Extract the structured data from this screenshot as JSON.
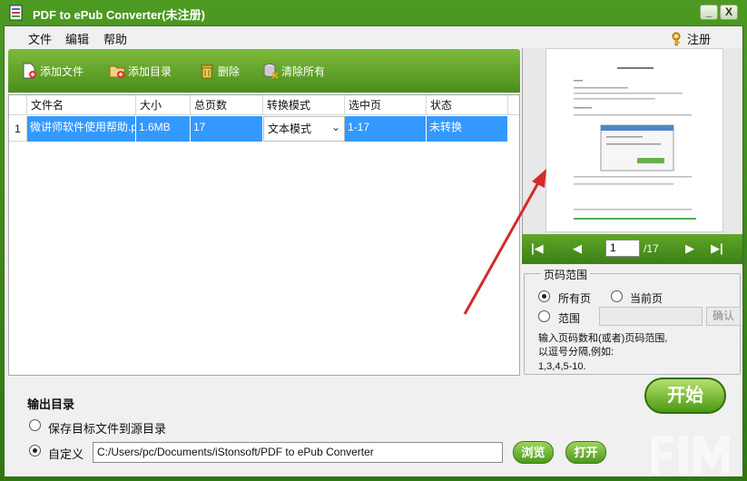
{
  "window": {
    "title": "PDF to ePub Converter(未注册)",
    "min_label": "_",
    "close_label": "X"
  },
  "menu": {
    "file": "文件",
    "edit": "编辑",
    "help": "帮助",
    "register": "注册"
  },
  "toolbar": {
    "add_file": "添加文件",
    "add_folder": "添加目录",
    "delete": "删除",
    "clear_all": "清除所有"
  },
  "table": {
    "headers": [
      "文件名",
      "大小",
      "总页数",
      "转换模式",
      "选中页",
      "状态"
    ],
    "rows": [
      {
        "index": "1",
        "filename": "微讲师软件使用帮助.pdf",
        "size": "1.6MB",
        "pages": "17",
        "mode": "文本模式",
        "selected": "1-17",
        "status": "未转换"
      }
    ]
  },
  "preview_nav": {
    "page": "1",
    "total": "/17"
  },
  "page_range": {
    "legend": "页码范围",
    "all_pages": "所有页",
    "current_page": "当前页",
    "range": "范围",
    "confirm": "确认",
    "hint_line1": "输入页码数和(或者)页码范围,",
    "hint_line2": "以逗号分隔,例如:",
    "hint_line3": "1,3,4,5-10."
  },
  "output": {
    "title": "输出目录",
    "save_to_source": "保存目标文件到源目录",
    "custom": "自定义",
    "path": "C:/Users/pc/Documents/iStonsoft/PDF to ePub Converter",
    "browse": "浏览",
    "open": "打开",
    "start": "开始"
  },
  "colors": {
    "brand_green": "#4d9a23",
    "selection_blue": "#3399ff",
    "arrow_red": "#d42a2a"
  }
}
